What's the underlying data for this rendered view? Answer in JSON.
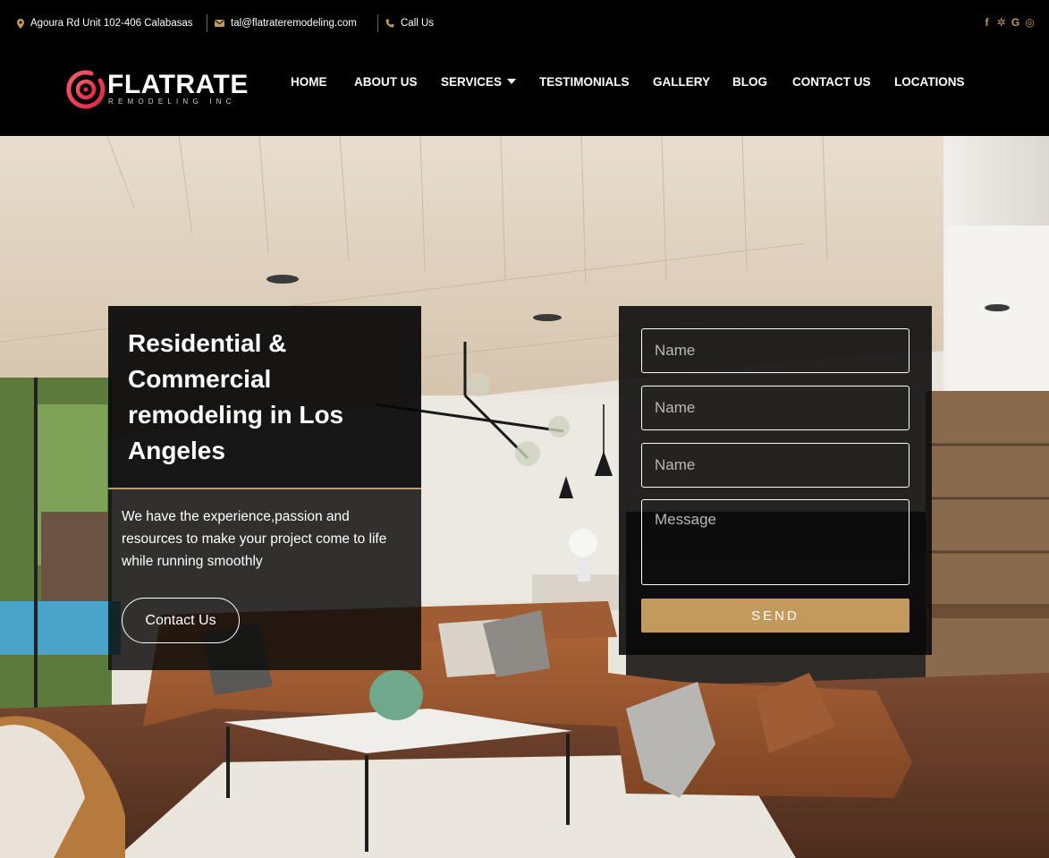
{
  "topbar": {
    "address": "Agoura Rd Unit 102-406 Calabasas",
    "email": "tal@flatrateremodeling.com",
    "phone": "Call Us",
    "socials": [
      {
        "icon": "facebook-icon",
        "glyph": "f"
      },
      {
        "icon": "yelp-icon",
        "glyph": "✲"
      },
      {
        "icon": "google-icon",
        "glyph": "G"
      },
      {
        "icon": "instagram-icon",
        "glyph": "◎"
      }
    ]
  },
  "brand": {
    "name": "FLATRATE",
    "tagline": "REMODELING INC"
  },
  "nav": {
    "items": [
      {
        "label": "HOME"
      },
      {
        "label": "ABOUT US"
      },
      {
        "label": "SERVICES",
        "has_dropdown": true
      },
      {
        "label": "TESTIMONIALS"
      },
      {
        "label": "GALLERY"
      },
      {
        "label": "BLOG"
      },
      {
        "label": "CONTACT US"
      },
      {
        "label": "LOCATIONS"
      }
    ]
  },
  "hero": {
    "title": "Residential & Commercial remodeling in Los Angeles",
    "description": "We have the experience,passion and resources to make your project come to life while running smoothly",
    "cta_label": "Contact Us"
  },
  "form": {
    "fields": [
      {
        "placeholder": "Name",
        "value": ""
      },
      {
        "placeholder": "Name",
        "value": ""
      },
      {
        "placeholder": "Name",
        "value": ""
      }
    ],
    "message_placeholder": "Message",
    "submit_label": "SEND"
  },
  "colors": {
    "accent": "#c39a5c",
    "logo_red": "#e9334d",
    "background": "#000000"
  }
}
